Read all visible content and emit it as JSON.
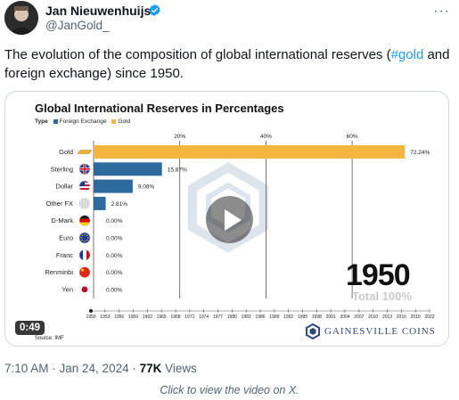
{
  "author": {
    "name": "Jan Nieuwenhuijs",
    "handle": "@JanGold_"
  },
  "tweet": {
    "text_before": "The evolution of the composition of global international reserves (",
    "hashtag": "#gold",
    "text_after": " and foreign exchange) since 1950."
  },
  "video": {
    "duration": "0:49",
    "title": "Global International Reserves in Percentages",
    "legend_label": "Type",
    "legend_items": [
      {
        "label": "Foreign Exchange",
        "color": "#2e6a9e"
      },
      {
        "label": "Gold",
        "color": "#f4b63f"
      }
    ],
    "current_year": "1950",
    "total_label": "Total 100%",
    "source": "Source: IMF",
    "brand": "GAINESVILLE COINS"
  },
  "chart_data": {
    "type": "bar",
    "title": "Global International Reserves in Percentages",
    "xlabel": "",
    "ylabel": "",
    "xlim": [
      0,
      80
    ],
    "grid_ticks": [
      "20%",
      "40%",
      "60%"
    ],
    "grid_values": [
      20,
      40,
      60
    ],
    "categories": [
      "Gold",
      "Sterling",
      "Dollar",
      "Other FX",
      "D-Mark",
      "Euro",
      "Franc",
      "Renminbi",
      "Yen"
    ],
    "values": [
      72.24,
      15.87,
      9.08,
      2.81,
      0,
      0,
      0,
      0,
      0
    ],
    "value_labels": [
      "72.24%",
      "15.87%",
      "9.08%",
      "2.81%",
      "0.00%",
      "0.00%",
      "0.00%",
      "0.00%",
      "0.00%"
    ],
    "series_types": [
      "gold",
      "fx",
      "fx",
      "fx",
      "fx",
      "fx",
      "fx",
      "fx",
      "fx"
    ],
    "colors": {
      "fx": "#2e6a9e",
      "gold": "#f4b63f"
    },
    "timeline_years": [
      "1950",
      "1953",
      "1956",
      "1959",
      "1962",
      "1965",
      "1968",
      "1971",
      "1974",
      "1977",
      "1980",
      "1983",
      "1986",
      "1989",
      "1992",
      "1995",
      "1998",
      "2001",
      "2004",
      "2007",
      "2010",
      "2013",
      "2016",
      "2019",
      "2022"
    ]
  },
  "footer": {
    "timestamp": "7:10 AM · Jan 24, 2024 · ",
    "views": "77K",
    "views_label": " Views",
    "note": "Click to view the video on X."
  }
}
